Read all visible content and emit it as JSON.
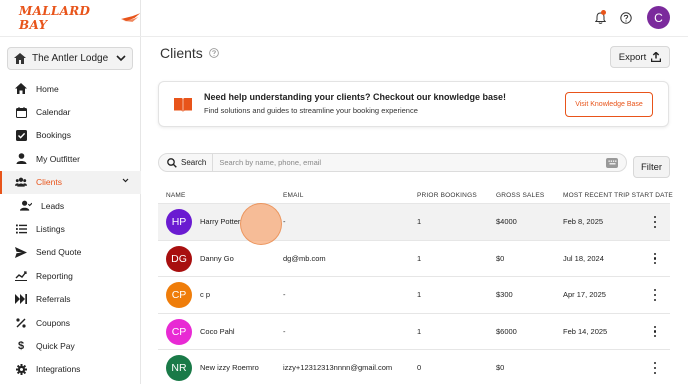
{
  "brand": {
    "logo_text": "MALLARD BAY"
  },
  "lodge": {
    "name": "The Antler Lodge"
  },
  "nav": {
    "items": [
      {
        "label": "Home",
        "icon": "home-icon"
      },
      {
        "label": "Calendar",
        "icon": "calendar-icon"
      },
      {
        "label": "Bookings",
        "icon": "bookings-icon"
      },
      {
        "label": "My Outfitter",
        "icon": "person-icon"
      },
      {
        "label": "Clients",
        "icon": "clients-icon",
        "active": true
      },
      {
        "label": "Leads",
        "icon": "leads-icon",
        "sub": true
      },
      {
        "label": "Listings",
        "icon": "list-icon"
      },
      {
        "label": "Send Quote",
        "icon": "send-icon"
      },
      {
        "label": "Reporting",
        "icon": "chart-icon"
      },
      {
        "label": "Referrals",
        "icon": "referrals-icon"
      },
      {
        "label": "Coupons",
        "icon": "percent-icon"
      },
      {
        "label": "Quick Pay",
        "icon": "dollar-icon"
      },
      {
        "label": "Integrations",
        "icon": "gear-icon"
      }
    ]
  },
  "header": {
    "avatar_initial": "C"
  },
  "page": {
    "title": "Clients",
    "export_label": "Export"
  },
  "knowledge_base": {
    "title": "Need help understanding your clients? Checkout our knowledge base!",
    "subtitle": "Find solutions and guides to streamline your booking experience",
    "button_label": "Visit Knowledge Base"
  },
  "search": {
    "button_label": "Search",
    "placeholder": "Search by name, phone, email",
    "filter_label": "Filter"
  },
  "table": {
    "columns": [
      "NAME",
      "EMAIL",
      "PRIOR BOOKINGS",
      "GROSS SALES",
      "MOST RECENT TRIP START DATE"
    ],
    "rows": [
      {
        "initials": "HP",
        "name": "Harry Potter",
        "email": "-",
        "prior_bookings": "1",
        "gross_sales": "$4000",
        "recent_trip": "Feb 8, 2025",
        "color": "#6a1bd1"
      },
      {
        "initials": "DG",
        "name": "Danny Go",
        "email": "dg@mb.com",
        "prior_bookings": "1",
        "gross_sales": "$0",
        "recent_trip": "Jul 18, 2024",
        "color": "#a80f0f"
      },
      {
        "initials": "CP",
        "name": "c p",
        "email": "-",
        "prior_bookings": "1",
        "gross_sales": "$300",
        "recent_trip": "Apr 17, 2025",
        "color": "#ef7d0a"
      },
      {
        "initials": "CP",
        "name": "Coco Pahl",
        "email": "-",
        "prior_bookings": "1",
        "gross_sales": "$6000",
        "recent_trip": "Feb 14, 2025",
        "color": "#e82ad4"
      },
      {
        "initials": "NR",
        "name": "New izzy Roemro",
        "email": "izzy+12312313nnnn@gmail.com",
        "prior_bookings": "0",
        "gross_sales": "$0",
        "recent_trip": "",
        "color": "#1a7a48"
      }
    ]
  }
}
